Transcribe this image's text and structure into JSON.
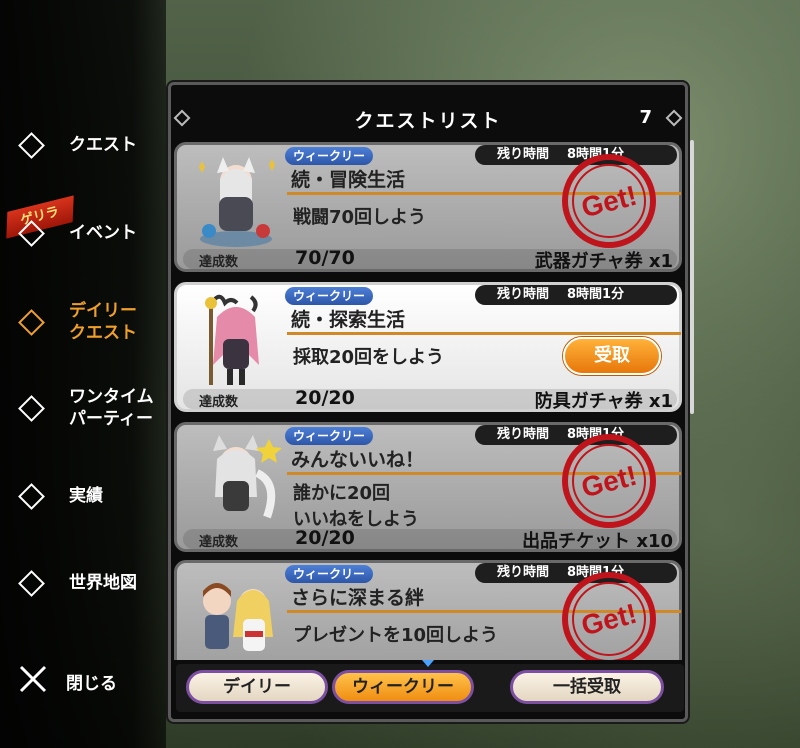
{
  "sidebar": {
    "items": [
      {
        "label": "クエスト",
        "active": false
      },
      {
        "label": "イベント",
        "active": false,
        "badge": "ゲリラ"
      },
      {
        "label": "デイリー\nクエスト",
        "active": true
      },
      {
        "label": "ワンタイム\nパーティー",
        "active": false
      },
      {
        "label": "実績",
        "active": false
      },
      {
        "label": "世界地図",
        "active": false
      }
    ],
    "close_label": "閉じる"
  },
  "panel": {
    "title": "クエストリスト",
    "count": "7"
  },
  "quests": [
    {
      "tag": "ウィークリー",
      "remaining_label": "残り時間",
      "remaining_time": "8時間1分",
      "title": "続・冒険生活",
      "objective": "戦闘70回しよう",
      "progress_label": "達成数",
      "progress": "70/70",
      "reward": "武器ガチャ券 x1",
      "status": "claimed",
      "stamp_text": "Get!"
    },
    {
      "tag": "ウィークリー",
      "remaining_label": "残り時間",
      "remaining_time": "8時間1分",
      "title": "続・探索生活",
      "objective": "採取20回をしよう",
      "progress_label": "達成数",
      "progress": "20/20",
      "reward": "防具ガチャ券 x1",
      "status": "claimable",
      "claim_label": "受取"
    },
    {
      "tag": "ウィークリー",
      "remaining_label": "残り時間",
      "remaining_time": "8時間1分",
      "title": "みんないいね！",
      "objective": "誰かに20回\nいいねをしよう",
      "progress_label": "達成数",
      "progress": "20/20",
      "reward": "出品チケット x10",
      "status": "claimed",
      "stamp_text": "Get!"
    },
    {
      "tag": "ウィークリー",
      "remaining_label": "残り時間",
      "remaining_time": "8時間1分",
      "title": "さらに深まる絆",
      "objective": "プレゼントを10回しよう",
      "status": "claimed",
      "stamp_text": "Get!"
    }
  ],
  "tabs": {
    "daily": "デイリー",
    "weekly": "ウィークリー",
    "claim_all": "一括受取",
    "active": "weekly"
  },
  "colors": {
    "accent": "#f0a02a",
    "tag_blue": "#3b6ac0",
    "stamp_red": "#c0141c",
    "divider": "#d08928"
  }
}
